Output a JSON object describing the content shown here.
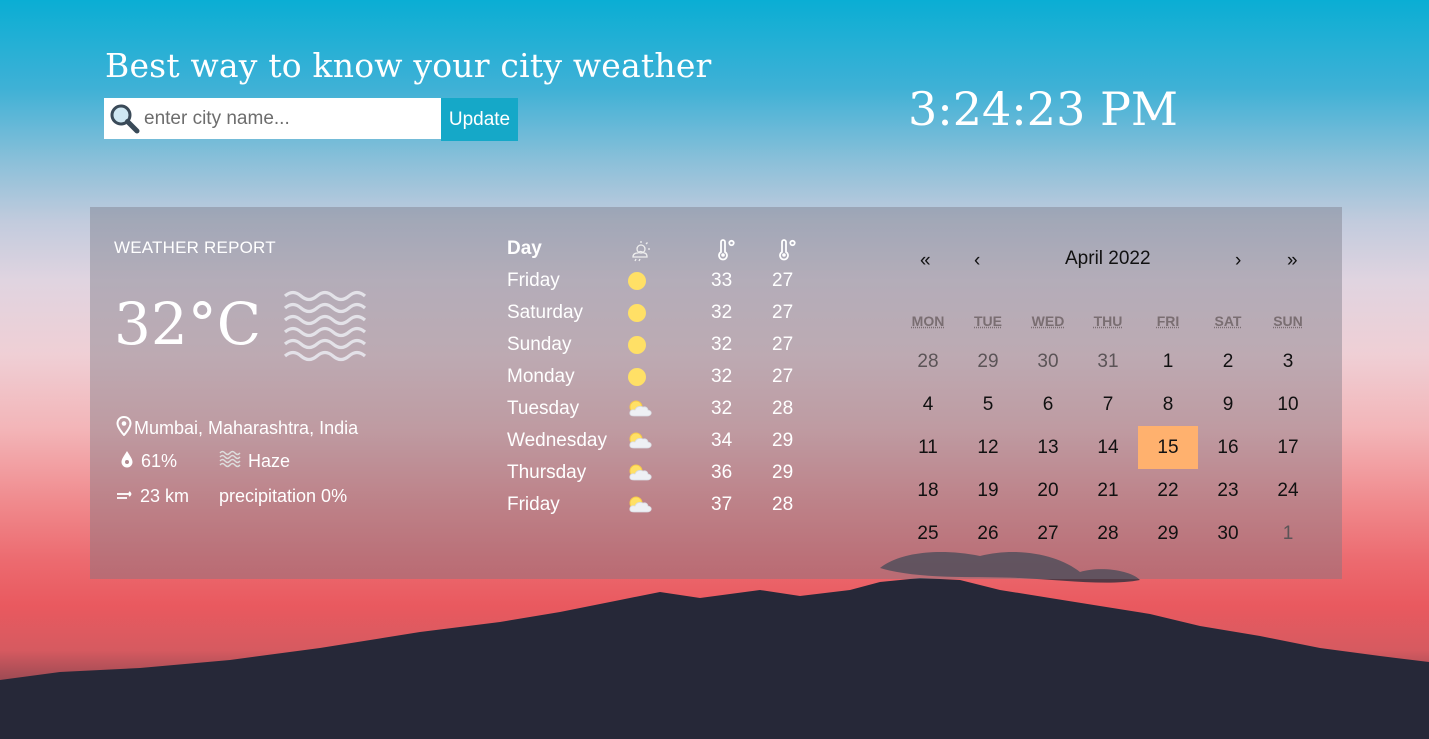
{
  "header": {
    "title": "Best way to know your city weather",
    "search_placeholder": "enter city name...",
    "update_label": "Update",
    "clock": "3:24:23 PM"
  },
  "report": {
    "title": "WEATHER REPORT",
    "temperature": "32°C",
    "condition_icon": "haze-icon",
    "location": "Mumbai, Maharashtra, India",
    "humidity": "61%",
    "condition": "Haze",
    "visibility": "23 km",
    "precipitation": "precipitation 0%"
  },
  "forecast": {
    "header_day": "Day",
    "rows": [
      {
        "day": "Friday",
        "icon": "sun-icon",
        "max": "33",
        "min": "27"
      },
      {
        "day": "Saturday",
        "icon": "sun-icon",
        "max": "32",
        "min": "27"
      },
      {
        "day": "Sunday",
        "icon": "sun-icon",
        "max": "32",
        "min": "27"
      },
      {
        "day": "Monday",
        "icon": "sun-icon",
        "max": "32",
        "min": "27"
      },
      {
        "day": "Tuesday",
        "icon": "partly-cloudy-icon",
        "max": "32",
        "min": "28"
      },
      {
        "day": "Wednesday",
        "icon": "partly-cloudy-icon",
        "max": "34",
        "min": "29"
      },
      {
        "day": "Thursday",
        "icon": "partly-cloudy-icon",
        "max": "36",
        "min": "29"
      },
      {
        "day": "Friday",
        "icon": "partly-cloudy-icon",
        "max": "37",
        "min": "28"
      }
    ]
  },
  "calendar": {
    "month_label": "April 2022",
    "prev_year": "«",
    "prev_month": "‹",
    "next_month": "›",
    "next_year": "»",
    "weekdays": [
      "MON",
      "TUE",
      "WED",
      "THU",
      "FRI",
      "SAT",
      "SUN"
    ],
    "weeks": [
      [
        "28",
        "29",
        "30",
        "31",
        "1",
        "2",
        "3"
      ],
      [
        "4",
        "5",
        "6",
        "7",
        "8",
        "9",
        "10"
      ],
      [
        "11",
        "12",
        "13",
        "14",
        "15",
        "16",
        "17"
      ],
      [
        "18",
        "19",
        "20",
        "21",
        "22",
        "23",
        "24"
      ],
      [
        "25",
        "26",
        "27",
        "28",
        "29",
        "30",
        "1"
      ]
    ],
    "today": "15",
    "today_color": "#ffb16e"
  },
  "colors": {
    "accent": "#15a8c8",
    "sun": "#ffe066"
  }
}
